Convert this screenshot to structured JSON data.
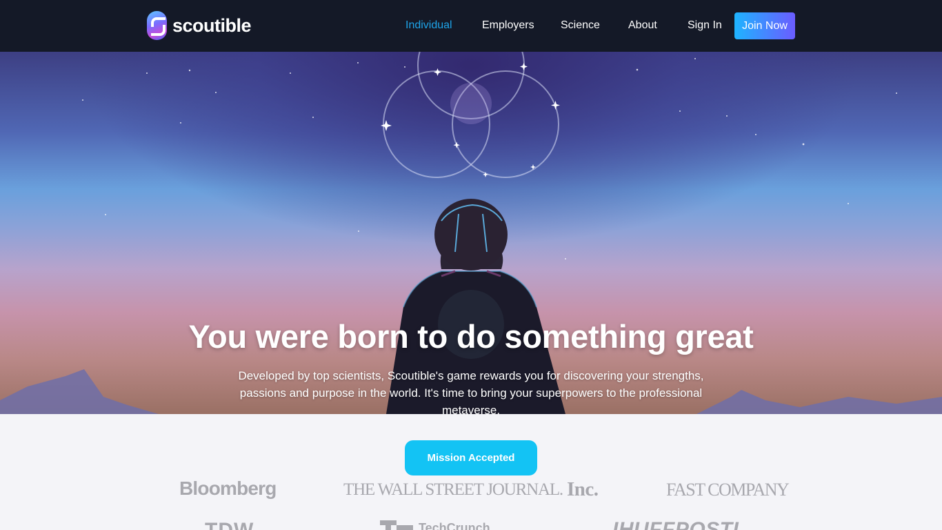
{
  "nav": {
    "brand": "scoutible",
    "items": [
      {
        "label": "Individual",
        "active": true
      },
      {
        "label": "Employers",
        "active": false
      },
      {
        "label": "Science",
        "active": false
      },
      {
        "label": "About",
        "active": false
      },
      {
        "label": "Sign In",
        "active": false
      }
    ],
    "cta_label": "Join Now"
  },
  "hero": {
    "title": "You were born to do something great",
    "subtitle": "Developed by top scientists, Scoutible's game rewards you for discovering your strengths, passions and purpose in the world. It's time to bring your superpowers to the professional metaverse."
  },
  "mission": {
    "label": "Mission Accepted"
  },
  "press": {
    "bloomberg": "Bloomberg",
    "wsj": "THE WALL STREET JOURNAL.",
    "inc": "Inc.",
    "fastco": "FAST COMPANY",
    "tdw": "TDW",
    "techcrunch": "TechCrunch",
    "huffpost": "IHUFFPOSTI"
  },
  "colors": {
    "nav_bg": "#141927",
    "accent_active": "#1ea4e9",
    "cta_gradient_start": "#1eb4ff",
    "cta_gradient_end": "#6b5cff",
    "mission_button": "#13c3f4",
    "page_bg": "#f4f4f8",
    "press_logo_gray": "#a8a8ae"
  }
}
